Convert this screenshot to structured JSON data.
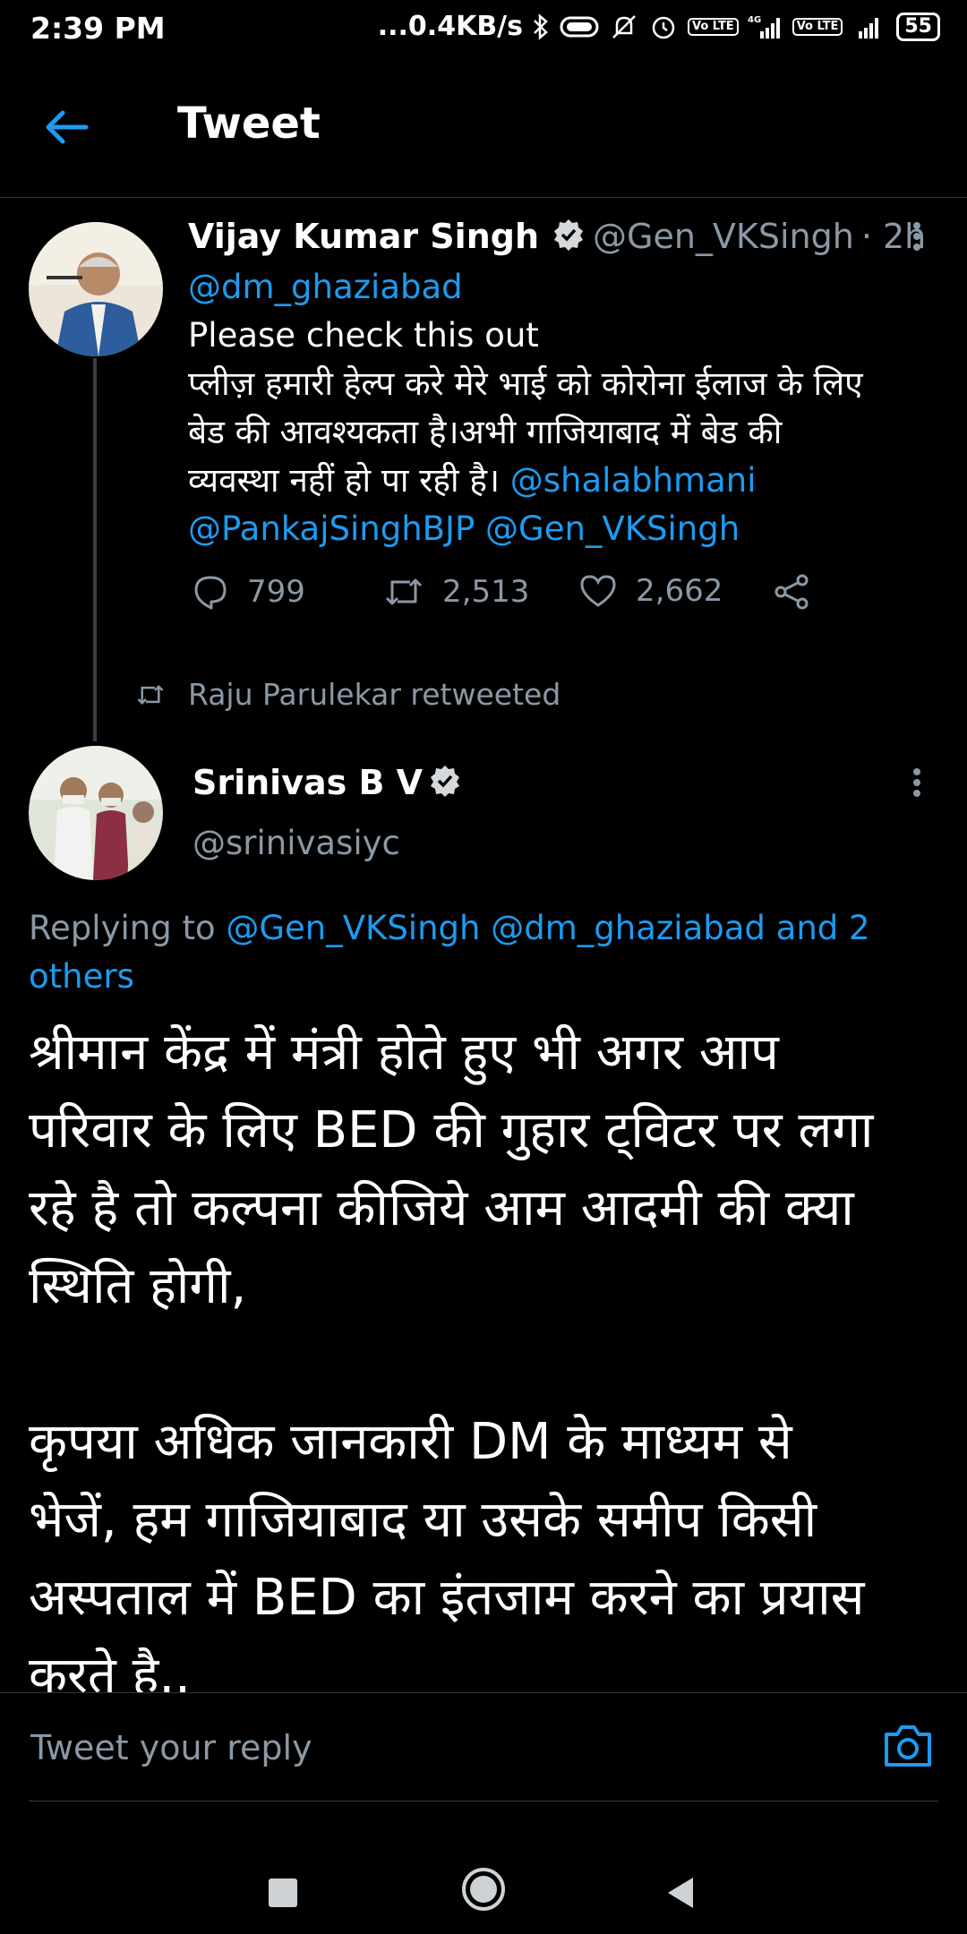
{
  "status_bar": {
    "time": "2:39 PM",
    "network_speed": "...0.4KB/s",
    "battery": "55",
    "lte_label": "Vo LTE",
    "net_label": "4G"
  },
  "header": {
    "title": "Tweet"
  },
  "tweet1": {
    "name": "Vijay Kumar Singh",
    "handle": "@Gen_VKSingh",
    "time": "· 2h",
    "mention": "@dm_ghaziabad",
    "line1": "Please check this out",
    "line2": "प्लीज़ हमारी हेल्प करे मेरे भाई को कोरोना ईलाज के लिए",
    "line3": "बेड की आवश्यकता है।अभी गाजियाबाद में बेड की",
    "line4_text": "व्यवस्था नहीं हो पा रही है। ",
    "line4_mention": "@shalabhmani",
    "line5_mention_a": "@PankajSinghBJP",
    "line5_mention_b": "@Gen_VKSingh",
    "replies": "799",
    "retweets": "2,513",
    "likes": "2,662"
  },
  "retweet_notice": "Raju Parulekar retweeted",
  "tweet2": {
    "name": "Srinivas B V",
    "handle": "@srinivasiyc",
    "replying_prefix": "Replying to ",
    "replying_line1_links": "@Gen_VKSingh @dm_ghaziabad and 2",
    "replying_line2_links": "others",
    "body_lines": [
      "श्रीमान केंद्र में मंत्री होते हुए भी अगर आप",
      "परिवार के लिए BED की गुहार ट्विटर पर लगा",
      "रहे है तो कल्पना कीजिये आम आदमी की क्या",
      "स्थिति होगी,",
      "",
      "कृपया अधिक जानकारी DM के माध्यम से",
      "भेजें, हम गाजियाबाद या उसके समीप किसी",
      "अस्पताल में BED का इंतजाम करने का प्रयास",
      "करते है.."
    ]
  },
  "reply_bar": {
    "placeholder": "Tweet your reply"
  },
  "colors": {
    "accent": "#1d9bf0",
    "muted": "#8b98a5",
    "background": "#000000"
  }
}
